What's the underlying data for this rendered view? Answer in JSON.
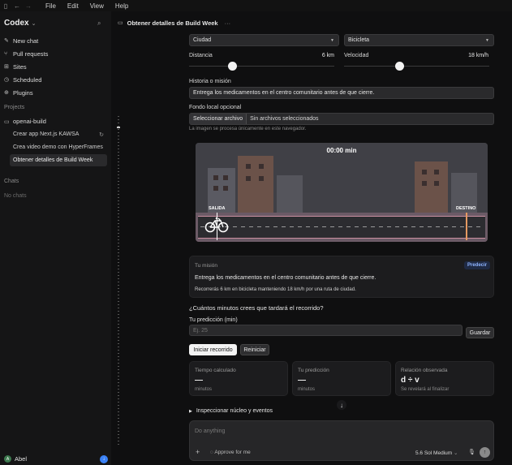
{
  "menu": {
    "items": [
      "File",
      "Edit",
      "View",
      "Help"
    ]
  },
  "sidebar": {
    "app_name": "Codex",
    "nav": [
      {
        "label": "New chat",
        "icon": "edit-icon"
      },
      {
        "label": "Pull requests",
        "icon": "pull-request-icon"
      },
      {
        "label": "Sites",
        "icon": "sites-icon"
      },
      {
        "label": "Scheduled",
        "icon": "clock-icon"
      },
      {
        "label": "Plugins",
        "icon": "plugin-icon"
      }
    ],
    "projects_label": "Projects",
    "project_name": "openai-build",
    "threads": [
      {
        "label": "Crear app Next.js KAWSA",
        "active": false,
        "loading": true
      },
      {
        "label": "Crea video demo con HyperFrames",
        "active": false,
        "loading": false
      },
      {
        "label": "Obtener detalles de Build Week",
        "active": true,
        "loading": false
      }
    ],
    "chats_label": "Chats",
    "no_chats": "No chats",
    "user_name": "Abel",
    "user_initial": "A"
  },
  "header": {
    "title": "Obtener detalles de Build Week",
    "more": "···"
  },
  "form": {
    "city_select": "Ciudad",
    "vehicle_select": "Bicicleta",
    "distance_label": "Distancia",
    "distance_value": "6 km",
    "distance_fraction": 0.3,
    "speed_label": "Velocidad",
    "speed_value": "18 km/h",
    "speed_fraction": 0.38,
    "story_label": "Historia o misión",
    "story_value": "Entrega los medicamentos en el centro comunitario antes de que cierre.",
    "bg_label": "Fondo local opcional",
    "file_button": "Seleccionar archivo",
    "file_status": "Sin archivos seleccionados",
    "bg_hint": "La imagen se procesa únicamente en este navegador."
  },
  "scene": {
    "timer": "00:00 min",
    "start_label": "SALIDA",
    "end_label": "DESTINO",
    "road_color": "#6b5a66",
    "end_pole_color": "#e59a62"
  },
  "mission": {
    "section_label": "Tu misión",
    "predict_badge": "Predecir",
    "text": "Entrega los medicamentos en el centro comunitario antes de que cierre.",
    "detail": "Recorrerás 6 km en bicicleta manteniendo 18 km/h por una ruta de ciudad."
  },
  "prediction": {
    "question": "¿Cuántos minutos crees que tardará el recorrido?",
    "label": "Tu predicción (min)",
    "placeholder": "Ej. 25",
    "save_button": "Guardar",
    "start_button": "Iniciar recorrido",
    "reset_button": "Reiniciar"
  },
  "stats": [
    {
      "title": "Tiempo calculado",
      "value": "—",
      "note": "minutos"
    },
    {
      "title": "Tu predicción",
      "value": "—",
      "note": "minutos"
    },
    {
      "title": "Relación observada",
      "value": "d ÷ v",
      "note": "Se revelará al finalizar"
    }
  ],
  "inspect_label": "Inspeccionar núcleo y eventos",
  "composer": {
    "placeholder": "Do anything",
    "approve": "Approve for me",
    "model": "5.6 Sol Medium"
  }
}
